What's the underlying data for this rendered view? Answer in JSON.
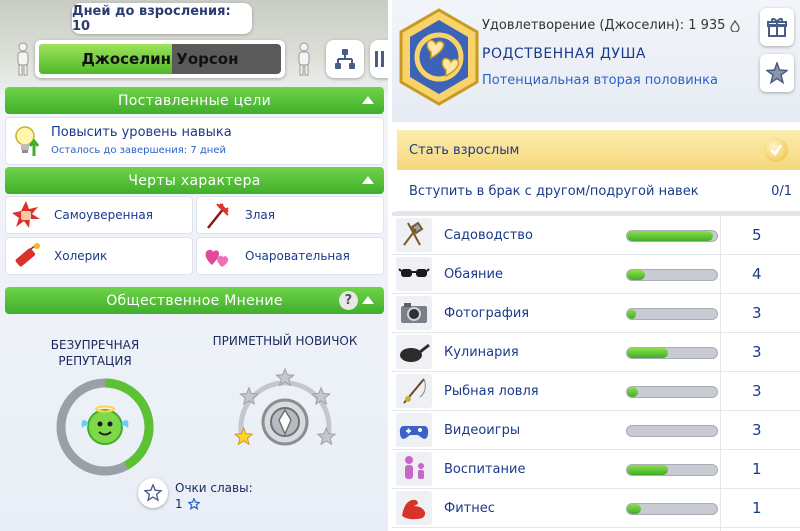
{
  "left": {
    "days_badge": "Дней до взросления: 10",
    "sim_name": "Джоселин Уорсон",
    "age_progress": 0.55,
    "goals": {
      "header": "Поставленные цели",
      "item_title": "Повысить уровень навыка",
      "item_subtitle": "Осталось до завершения: 7 дней"
    },
    "traits": {
      "header": "Черты характера",
      "items": [
        {
          "label": "Самоуверенная",
          "icon": "fist-burst-icon"
        },
        {
          "label": "Злая",
          "icon": "pitchfork-icon"
        },
        {
          "label": "Холерик",
          "icon": "dynamite-icon"
        },
        {
          "label": "Очаровательная",
          "icon": "hearts-icon"
        }
      ]
    },
    "opinion": {
      "header": "Общественное Мнение",
      "help": "?",
      "rep_title": "Безупречная репутация",
      "rep_title_line1": "БЕЗУПРЕЧНАЯ",
      "rep_title_line2": "РЕПУТАЦИЯ",
      "rep_level": 0.42,
      "fame_title": "ПРИМЕТНЫЙ НОВИЧОК",
      "fame_stars": 1,
      "fame_points_label": "Очки славы:",
      "fame_points_value": "1"
    }
  },
  "right": {
    "satisfaction": "Удовлетворение (Джоселин): 1 935",
    "aspiration_name": "Родственная душа",
    "aspiration_desc": "Потенциальная вторая половинка",
    "milestones": [
      {
        "label": "Стать взрослым",
        "done": true,
        "progress": ""
      },
      {
        "label": "Вступить в брак с другом/подругой навек",
        "done": false,
        "progress": "0/1"
      }
    ],
    "skills": [
      {
        "label": "Садоводство",
        "level": "5",
        "progress": 0.95,
        "icon": "shovel-rake-icon"
      },
      {
        "label": "Обаяние",
        "level": "4",
        "progress": 0.2,
        "icon": "sunglasses-icon"
      },
      {
        "label": "Фотография",
        "level": "3",
        "progress": 0.1,
        "icon": "camera-icon"
      },
      {
        "label": "Кулинария",
        "level": "3",
        "progress": 0.45,
        "icon": "frying-pan-icon"
      },
      {
        "label": "Рыбная ловля",
        "level": "3",
        "progress": 0.12,
        "icon": "fishing-rod-icon"
      },
      {
        "label": "Видеоигры",
        "level": "3",
        "progress": 0.0,
        "icon": "gamepad-icon"
      },
      {
        "label": "Воспитание",
        "level": "1",
        "progress": 0.45,
        "icon": "parenting-icon"
      },
      {
        "label": "Фитнес",
        "level": "1",
        "progress": 0.15,
        "icon": "muscle-arm-icon"
      }
    ]
  },
  "colors": {
    "accent_green": "#4fb82a",
    "text_blue": "#1a3a8a",
    "link_blue": "#2a63c9",
    "gold": "#f5d87a"
  }
}
